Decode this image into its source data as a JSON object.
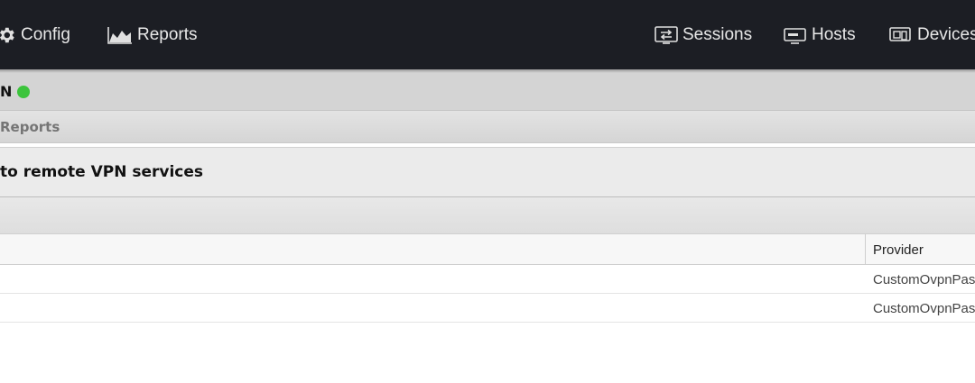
{
  "nav": {
    "config": {
      "label": "Config",
      "icon": "gear-icon"
    },
    "reports": {
      "label": "Reports",
      "icon": "area-chart-icon"
    },
    "sessions": {
      "label": "Sessions",
      "icon": "sessions-icon"
    },
    "hosts": {
      "label": "Hosts",
      "icon": "hosts-icon"
    },
    "devices": {
      "label": "Devices",
      "icon": "devices-icon"
    }
  },
  "app": {
    "title": "N",
    "status_color": "#3cc43c"
  },
  "breadcrumb": "Reports",
  "report": {
    "title": "to remote VPN services"
  },
  "table": {
    "columns": [
      "Provider"
    ],
    "rows": [
      {
        "provider": "CustomOvpnPas"
      },
      {
        "provider": "CustomOvpnPas"
      }
    ]
  },
  "colors": {
    "topbar": "#1c1e24",
    "accent_green": "#3cc43c"
  }
}
